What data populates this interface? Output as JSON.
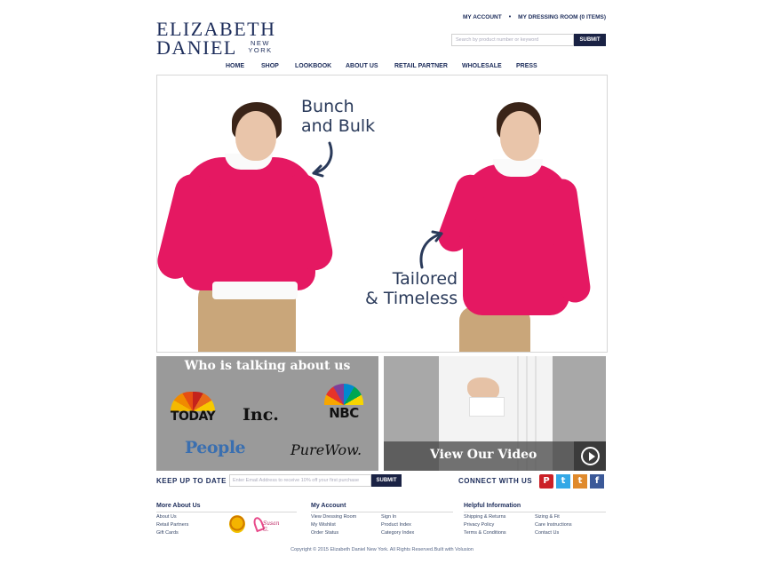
{
  "logo": {
    "line1": "ELIZABETH",
    "line2": "DANIEL",
    "line3": "NEW YORK"
  },
  "top_links": {
    "account": "MY ACCOUNT",
    "separator": "•",
    "dressing_room": "MY DRESSING ROOM (0 ITEMS)"
  },
  "search": {
    "placeholder": "Search by product number or keyword",
    "button": "SUBMIT"
  },
  "nav": [
    "HOME",
    "SHOP",
    "LOOKBOOK",
    "ABOUT US",
    "RETAIL PARTNER",
    "WHOLESALE",
    "PRESS"
  ],
  "hero": {
    "caption_left": "Bunch\nand Bulk",
    "caption_right": "Tailored\n& Timeless"
  },
  "press": {
    "title": "Who is talking about us",
    "brands": {
      "today": "TODAY",
      "inc": "Inc.",
      "nbc": "NBC",
      "people": "People",
      "purewow": "PureWow."
    }
  },
  "video": {
    "label": "View Our Video"
  },
  "newsletter": {
    "label": "KEEP UP TO DATE",
    "placeholder": "Enter Email Address to receive 10% off your first purchase",
    "button": "SUBMIT"
  },
  "connect": {
    "label": "CONNECT WITH US",
    "icons": [
      "pinterest-icon",
      "twitter-icon",
      "tumblr-icon",
      "facebook-icon"
    ],
    "glyphs": [
      "P",
      "t",
      "t",
      "f"
    ]
  },
  "footer": {
    "more_about": {
      "heading": "More About Us",
      "links": [
        "About Us",
        "Retail Partners",
        "Gift Cards"
      ]
    },
    "account": {
      "heading": "My Account",
      "links_col1": [
        "View Dressing Room",
        "My Wishlist",
        "Order Status"
      ],
      "links_col2": [
        "Sign In",
        "Product Index",
        "Category Index"
      ]
    },
    "helpful": {
      "heading": "Helpful Information",
      "links_col1": [
        "Shipping & Returns",
        "Privacy Policy",
        "Terms & Conditions"
      ],
      "links_col2": [
        "Sizing & Fit",
        "Care Instructions",
        "Contact Us"
      ]
    },
    "badge_text": "Susan G."
  },
  "copyright": "Copyright © 2015 Elizabeth Daniel New York. All Rights Reserved.Built with Volusion",
  "colors": {
    "navy": "#1a2244",
    "sweater_pink": "#e51862",
    "panel_gray": "#9a9a9a"
  }
}
